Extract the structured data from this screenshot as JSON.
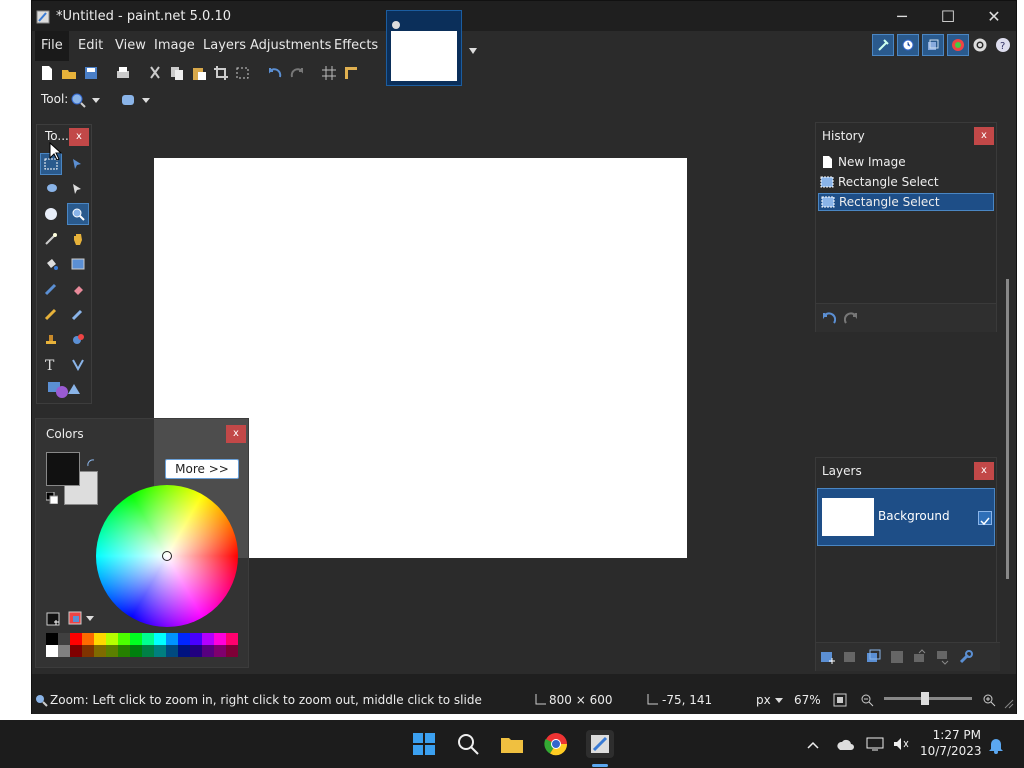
{
  "window": {
    "title": "*Untitled - paint.net 5.0.10",
    "controls": {
      "minimize": "─",
      "maximize": "☐",
      "close": "✕"
    }
  },
  "menu": {
    "items": [
      "File",
      "Edit",
      "View",
      "Image",
      "Layers",
      "Adjustments",
      "Effects"
    ],
    "active_index": 0
  },
  "toolbar": {
    "icons": [
      "new-icon",
      "open-icon",
      "save-icon",
      "print-icon",
      "cut-icon",
      "copy-icon",
      "paste-icon",
      "crop-icon",
      "deselect-icon",
      "undo-icon",
      "redo-icon",
      "grid-icon",
      "ruler-icon"
    ],
    "tool_label": "Tool:"
  },
  "tools_panel": {
    "title": "To...",
    "close": "x"
  },
  "colors_panel": {
    "title": "Colors",
    "close": "x",
    "more_button": "More >>",
    "primary_color": "#111111",
    "secondary_color": "#dddddd"
  },
  "history_panel": {
    "title": "History",
    "close": "x",
    "items": [
      "New Image",
      "Rectangle Select",
      "Rectangle Select"
    ],
    "selected_index": 2
  },
  "layers_panel": {
    "title": "Layers",
    "close": "x",
    "layer_name": "Background"
  },
  "statusbar": {
    "hint": "Zoom: Left click to zoom in, right click to zoom out, middle click to slide",
    "image_size": "800 × 600",
    "cursor_pos": "-75, 141",
    "units": "px",
    "zoom": "67%",
    "zoom_level": 0.67
  },
  "taskbar": {
    "time": "1:27 PM",
    "date": "10/7/2023"
  },
  "colors": {
    "accent": "#4a86c3",
    "selection": "#1e4e87",
    "close_red": "#c24848"
  }
}
